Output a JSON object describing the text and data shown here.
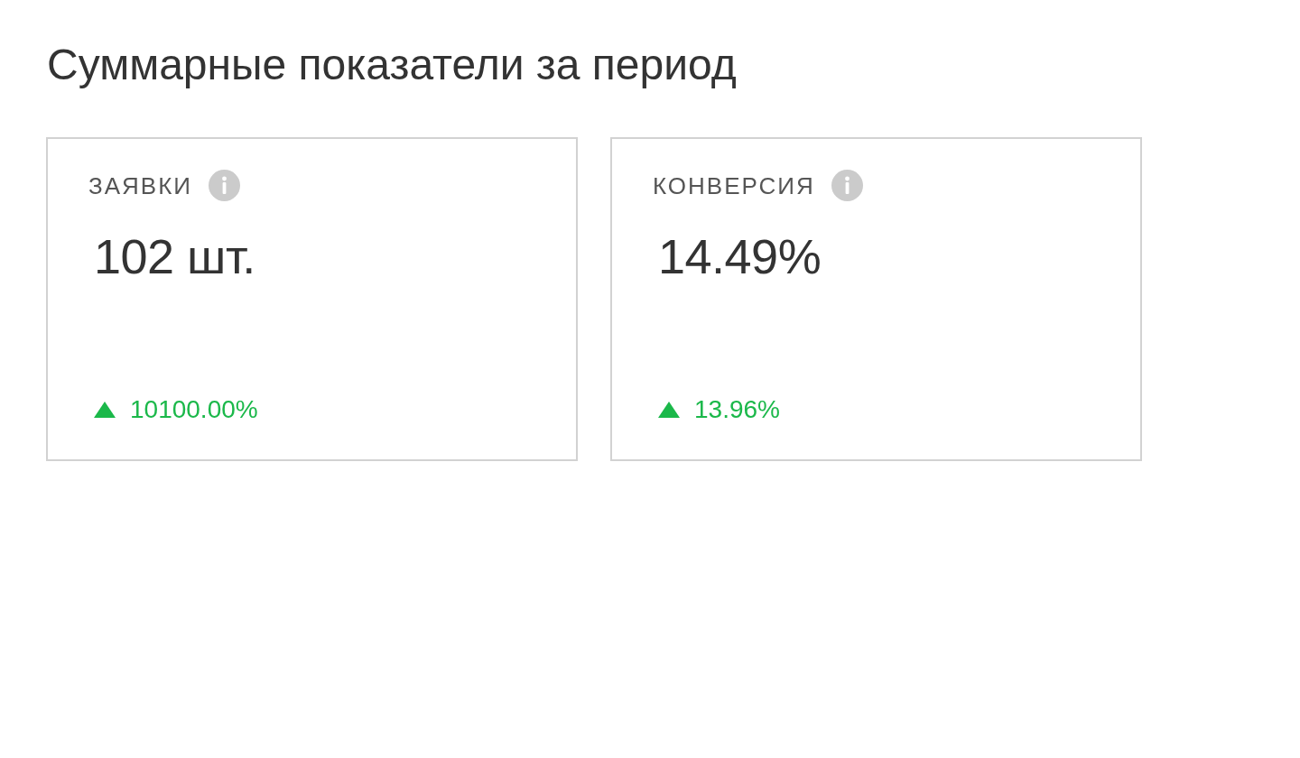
{
  "title": "Суммарные показатели за период",
  "cards": [
    {
      "label": "ЗАЯВКИ",
      "value": "102 шт.",
      "change": {
        "kind": "up",
        "text": "10100.00%"
      }
    },
    {
      "label": "КОНВЕРСИЯ",
      "value": "14.49%",
      "change": {
        "kind": "up",
        "text": "13.96%"
      }
    }
  ]
}
